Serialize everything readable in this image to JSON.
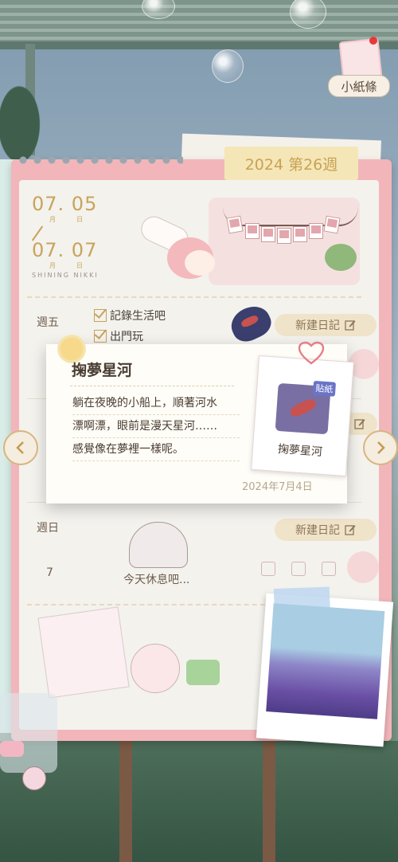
{
  "header": {
    "week_label": "2024 第26週",
    "note_button_label": "小紙條"
  },
  "date_range": {
    "start": "07. 05",
    "start_month_unit": "月",
    "start_day_unit": "日",
    "end": "07. 07",
    "end_month_unit": "月",
    "end_day_unit": "日",
    "brand": "SHINING NIKKI"
  },
  "days": [
    {
      "weekday": "週五",
      "new_diary_label": "新建日記"
    },
    {
      "weekday": "週日",
      "day_number": "7",
      "new_diary_label": "新建日記",
      "rest_text": "今天休息吧..."
    }
  ],
  "todos": [
    {
      "text": "記錄生活吧"
    },
    {
      "text": "出門玩"
    }
  ],
  "popup": {
    "title": "掬夢星河",
    "body_lines": [
      "躺在夜晚的小船上，順著河水",
      "漂啊漂，眼前是漫天星河……",
      "感覺像在夢裡一樣呢。"
    ],
    "date": "2024年7月4日",
    "sticker_badge": "貼紙",
    "sticker_name": "掬夢星河"
  },
  "icons": {
    "prev": "chevron-left-icon",
    "next": "chevron-right-icon",
    "edit": "edit-icon",
    "heart": "heart-icon"
  },
  "colors": {
    "board_pink": "#f2b6ba",
    "accent_gold": "#c9a35c",
    "paper": "#f3f2ed"
  }
}
